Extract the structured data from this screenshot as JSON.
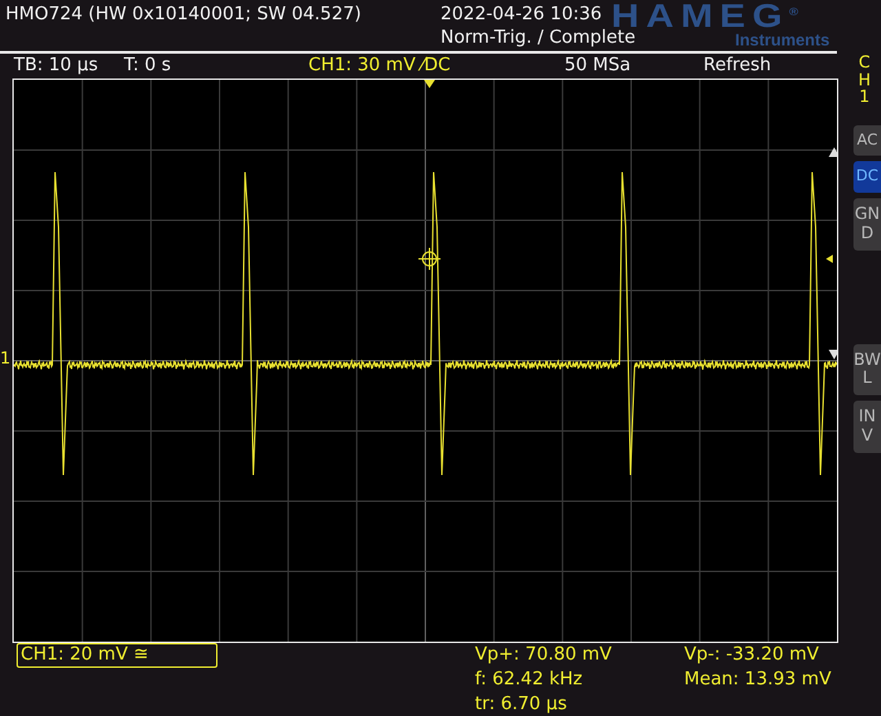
{
  "header": {
    "device": "HMO724 (HW 0x10140001; SW 04.527)",
    "datetime": "2022-04-26 10:36",
    "trigger_status": "Norm-Trig. / Complete",
    "logo": "HAMEG$^{®}$",
    "logo_sub": "Instruments"
  },
  "status_bar": {
    "timebase": "TB: 10 µs",
    "trigger_time": "T: 0 s",
    "channel": "CH1: 30 mV ⁄DC",
    "sample_rate": "50 MSa",
    "mode": "Refresh"
  },
  "graticule": {
    "channel_marker": "1"
  },
  "side_panel": {
    "channel": "CH1",
    "coupling": [
      {
        "label": "AC",
        "selected": false
      },
      {
        "label": "DC",
        "selected": true
      },
      {
        "label": "GND",
        "selected": false
      }
    ],
    "toggles": [
      {
        "label": "BWL",
        "on": false
      },
      {
        "label": "INV",
        "on": false
      }
    ]
  },
  "footer": {
    "channel_scale": "CH1: 20 mV ≅",
    "measurements": [
      {
        "label": "Vp+: 70.80 mV"
      },
      {
        "label": "Vp-: -33.20 mV"
      },
      {
        "label": "f: 62.42 kHz"
      },
      {
        "label": "Mean: 13.93 mV"
      },
      {
        "label": "tr: 6.70 µs"
      }
    ]
  }
}
